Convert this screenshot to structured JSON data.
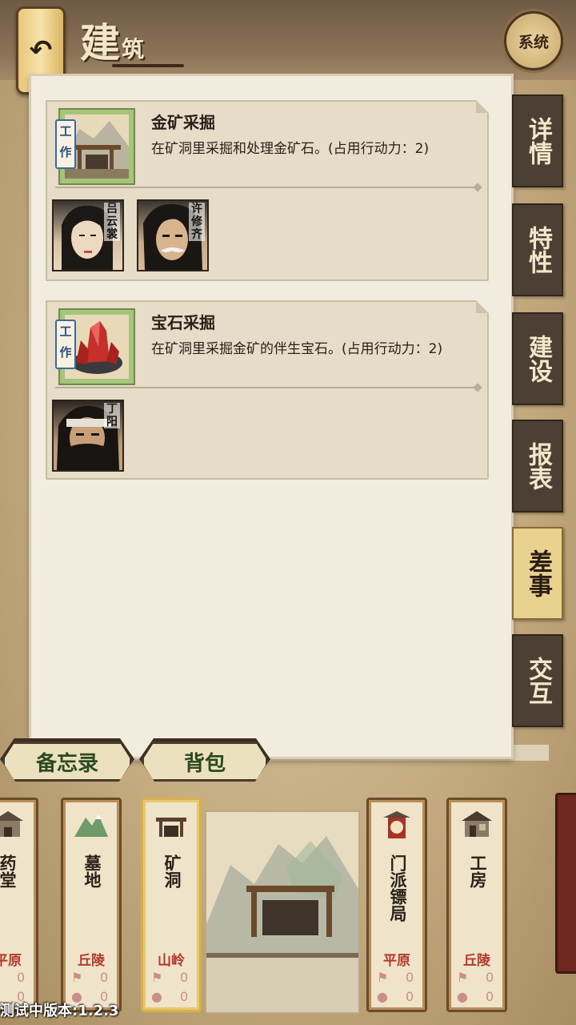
{
  "header": {
    "back_icon": "return-arrow-icon",
    "title_main": "建",
    "title_sub": "筑",
    "system_label": "系统"
  },
  "jobs": [
    {
      "tag": "工作",
      "title": "金矿采掘",
      "desc": "在矿洞里采掘和处理金矿石。(占用行动力：2)",
      "icon": "mine-cart-icon",
      "workers": [
        "吕云裳",
        "许修齐"
      ]
    },
    {
      "tag": "工作",
      "title": "宝石采掘",
      "desc": "在矿洞里采掘金矿的伴生宝石。(占用行动力：2)",
      "icon": "red-gem-icon",
      "workers": [
        "丁阳"
      ]
    }
  ],
  "side_tabs": [
    {
      "label": "详情",
      "active": false
    },
    {
      "label": "特性",
      "active": false
    },
    {
      "label": "建设",
      "active": false
    },
    {
      "label": "报表",
      "active": false
    },
    {
      "label": "差事",
      "active": true
    },
    {
      "label": "交互",
      "active": false
    }
  ],
  "ribbons": {
    "memo": "备忘录",
    "bag": "背包"
  },
  "buildings": [
    {
      "name": "药堂",
      "terrain": "平原",
      "stat1": "0",
      "stat2": "0",
      "icon": "building-icon"
    },
    {
      "name": "墓地",
      "terrain": "丘陵",
      "stat1": "0",
      "stat2": "0",
      "icon": "mountain-icon"
    },
    {
      "name": "矿洞",
      "terrain": "山岭",
      "stat1": "0",
      "stat2": "0",
      "icon": "mine-icon",
      "selected": true
    },
    {
      "name": "门派镖局",
      "terrain": "平原",
      "stat1": "0",
      "stat2": "0",
      "icon": "escort-banner-icon"
    },
    {
      "name": "工房",
      "terrain": "丘陵",
      "stat1": "0",
      "stat2": "0",
      "icon": "workshop-icon"
    }
  ],
  "version": "测试中版本:1.2.3",
  "colors": {
    "accent": "#e9d190",
    "terrain": "#b23a2e",
    "tab_dark": "#4d3f33"
  }
}
